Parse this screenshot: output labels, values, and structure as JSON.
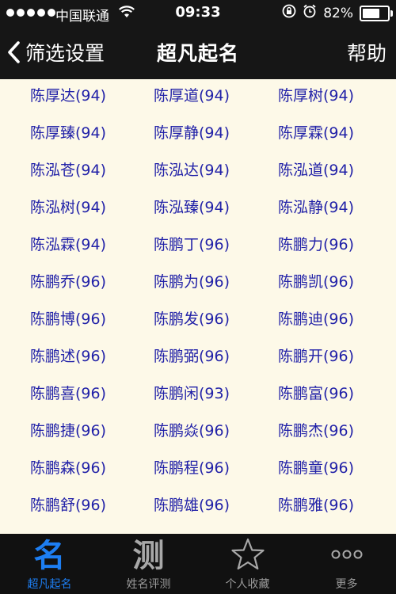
{
  "status_bar": {
    "carrier": "中国联通",
    "time": "09:33",
    "battery_percent": "82%",
    "battery_level": 0.82
  },
  "nav": {
    "back_label": "筛选设置",
    "title": "超凡起名",
    "help_label": "帮助"
  },
  "names": [
    "陈厚达(94)",
    "陈厚道(94)",
    "陈厚树(94)",
    "陈厚臻(94)",
    "陈厚静(94)",
    "陈厚霖(94)",
    "陈泓苍(94)",
    "陈泓达(94)",
    "陈泓道(94)",
    "陈泓树(94)",
    "陈泓臻(94)",
    "陈泓静(94)",
    "陈泓霖(94)",
    "陈鹏丁(96)",
    "陈鹏力(96)",
    "陈鹏乔(96)",
    "陈鹏为(96)",
    "陈鹏凯(96)",
    "陈鹏博(96)",
    "陈鹏发(96)",
    "陈鹏迪(96)",
    "陈鹏述(96)",
    "陈鹏弼(96)",
    "陈鹏开(96)",
    "陈鹏喜(96)",
    "陈鹏闲(93)",
    "陈鹏富(96)",
    "陈鹏捷(96)",
    "陈鹏焱(96)",
    "陈鹏杰(96)",
    "陈鹏森(96)",
    "陈鹏程(96)",
    "陈鹏童(96)",
    "陈鹏舒(96)",
    "陈鹏雄(96)",
    "陈鹏雅(96)"
  ],
  "tabs": [
    {
      "label": "超凡起名",
      "icon": "ming-glyph-icon",
      "glyph": "名",
      "active": true
    },
    {
      "label": "姓名评测",
      "icon": "ce-glyph-icon",
      "glyph": "测",
      "active": false
    },
    {
      "label": "个人收藏",
      "icon": "star-icon",
      "active": false
    },
    {
      "label": "更多",
      "icon": "more-dots-icon",
      "active": false
    }
  ],
  "colors": {
    "header_bg": "#161616",
    "content_bg": "#fdf9e8",
    "name_text": "#2222a8",
    "tab_active": "#1d7ef2",
    "tab_inactive": "#9a9a9a"
  }
}
